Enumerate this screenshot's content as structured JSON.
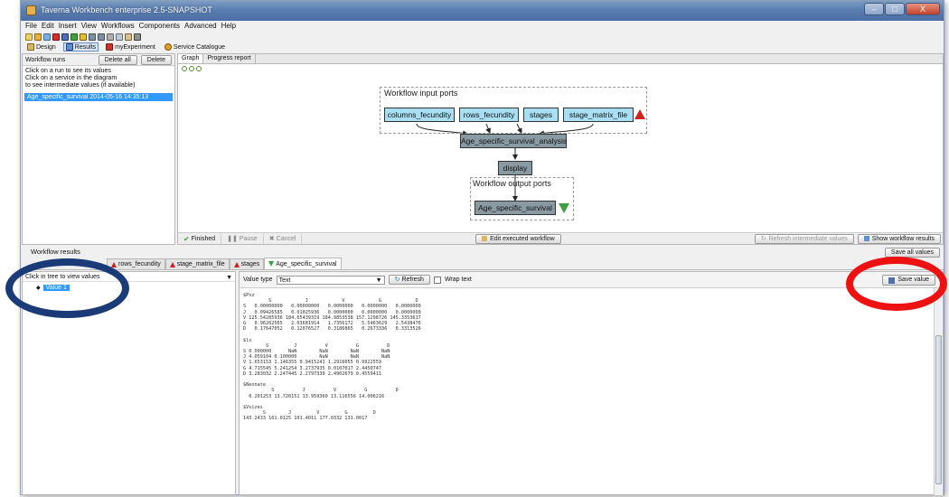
{
  "window": {
    "title": "Taverna Workbench enterprise 2.5-SNAPSHOT",
    "controls": [
      "–",
      "□",
      "X"
    ]
  },
  "menu": [
    "File",
    "Edit",
    "Insert",
    "View",
    "Workflows",
    "Components",
    "Advanced",
    "Help"
  ],
  "perspectives": [
    {
      "label": "Design",
      "active": false
    },
    {
      "label": "Results",
      "active": true
    },
    {
      "label": "myExperiment",
      "active": false
    },
    {
      "label": "Service Catalogue",
      "active": false
    }
  ],
  "workflow_runs": {
    "title": "Workflow runs",
    "delete_all": "Delete all",
    "delete": "Delete",
    "hint_lines": [
      "Click on a run to see its values",
      "Click on a service in the diagram",
      "to see intermediate values (if available)"
    ],
    "runs": [
      "Age_specific_survival 2014-05-16 14:35:13"
    ]
  },
  "graph_tabs": [
    "Graph",
    "Progress report"
  ],
  "diagram": {
    "inputs_label": "Workflow input ports",
    "input_ports": [
      "columns_fecundity",
      "rows_fecundity",
      "stages",
      "stage_matrix_file"
    ],
    "processor": "Age_specific_survival_analysis",
    "display": "display",
    "outputs_label": "Workflow output ports",
    "output_port": "Age_specific_survival"
  },
  "run_status": {
    "finished": "Finished",
    "pause": "Pause",
    "cancel": "Cancel",
    "edit": "Edit executed workflow",
    "refresh": "Refresh intermediate values",
    "show": "Show workflow results"
  },
  "results": {
    "title": "Workflow results",
    "save_all": "Save all values",
    "tabs": [
      {
        "label": "rows_fecundity",
        "icon": "red"
      },
      {
        "label": "stage_matrix_file",
        "icon": "red"
      },
      {
        "label": "stages",
        "icon": "red"
      },
      {
        "label": "Age_specific_survival",
        "icon": "green"
      }
    ],
    "tree_hint": "Click in tree to view values",
    "tree_value": "Value 1",
    "value_type_label": "Value type",
    "value_type": "Text",
    "refresh": "Refresh",
    "wrap_text": "Wrap text",
    "save_value": "Save value",
    "value_text": "$Pxz\n         S            J            V            G            D\nS   0.00000000   0.00000000   0.0000000   0.0000000   0.0000000\nJ   0.09426585   0.01025936   0.0000000   0.0000000   0.0000000\nV 125.54285936 184.65439319 184.9853538 157.1298726 145.3353617\nG   0.96262565   2.03681914   1.7356172   5.5463629   2.5438476\nD   0.17647052   0.12076527   0.3186865   0.2673336   0.3313526\n\n$lx\n        S         J          V          G          D\nS 0.000000      NaN        NaN        NaN        NaN\nJ 4.059104 0.100000        NaN        NaN        NaN\nV 1.653153 1.146355 0.9415241 1.2916055 0.9922559\nG 4.715545 5.241254 3.2737935 0.0107017 2.4450747\nD 3.283032 2.247445 2.2797330 2.4902679 0.4559411\n\n$Neonate\n          S          J          V          G          D\n  0.201253 13.720151 13.959360 13.116556 14.006216\n\n$Vsizes\n       S        J         V         G         D\n143.2433 161.0125 101.4011 177.0332 131.0017"
  }
}
